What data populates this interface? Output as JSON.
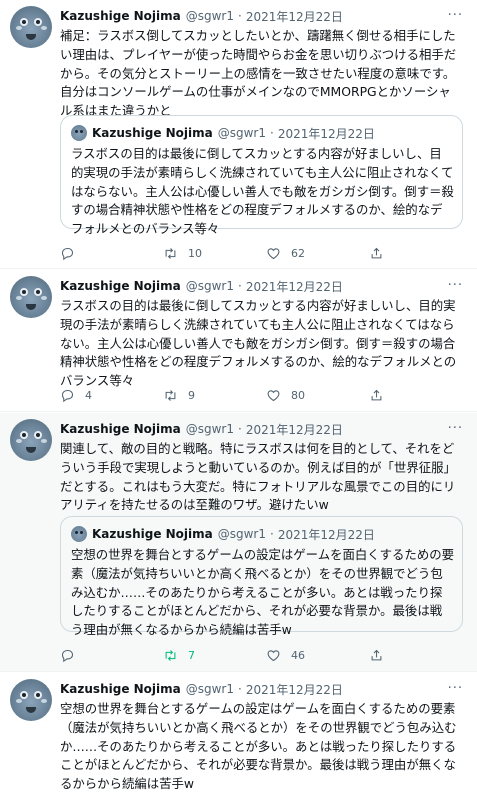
{
  "tweets": [
    {
      "author": "Kazushige Nojima",
      "handle": "@sgwr1",
      "date": "2021年12月22日",
      "text": "補足：ラスボス倒してスカッとしたいとか、躊躇無く倒せる相手にしたい理由は、プレイヤーが使った時間やらお金を思い切りぶつける相手だから。その気分とストーリー上の感情を一致させたい程度の意味です。自分はコンソールゲームの仕事がメインなのでMMORPGとかソーシャル系はまた違うかと",
      "quote": {
        "author": "Kazushige Nojima",
        "handle": "@sgwr1",
        "date": "2021年12月22日",
        "text": "ラスボスの目的は最後に倒してスカッとする内容が好ましいし、目的実現の手法が素晴らしく洗練されていても主人公に阻止されなくてはならない。主人公は心優しい善人でも敵をガシガシ倒す。倒す＝殺すの場合精神状態や性格をどの程度デフォルメするのか、絵的なデフォルメとのバランス等々"
      },
      "reply_count": "",
      "retweet_count": "10",
      "like_count": "62"
    },
    {
      "author": "Kazushige Nojima",
      "handle": "@sgwr1",
      "date": "2021年12月22日",
      "text": "ラスボスの目的は最後に倒してスカッとする内容が好ましいし、目的実現の手法が素晴らしく洗練されていても主人公に阻止されなくてはならない。主人公は心優しい善人でも敵をガシガシ倒す。倒す＝殺すの場合精神状態や性格をどの程度デフォルメするのか、絵的なデフォルメとのバランス等々",
      "reply_count": "4",
      "retweet_count": "9",
      "like_count": "80"
    },
    {
      "author": "Kazushige Nojima",
      "handle": "@sgwr1",
      "date": "2021年12月22日",
      "text": "関連して、敵の目的と戦略。特にラスボスは何を目的として、それをどういう手段で実現しようと動いているのか。例えば目的が「世界征服」だとする。これはもう大変だ。特にフォトリアルな風景でこの目的にリアリティを持たせるのは至難のワザ。避けたいw",
      "quote": {
        "author": "Kazushige Nojima",
        "handle": "@sgwr1",
        "date": "2021年12月22日",
        "text": "空想の世界を舞台とするゲームの設定はゲームを面白くするための要素（魔法が気持ちいいとか高く飛べるとか）をその世界観でどう包み込むか……そのあたりから考えることが多い。あとは戦ったり探したりすることがほとんどだから、それが必要な背景か。最後は戦う理由が無くなるからから続編は苦手w"
      },
      "reply_count": "",
      "retweet_count": "7",
      "like_count": "46",
      "retweeted": true
    },
    {
      "author": "Kazushige Nojima",
      "handle": "@sgwr1",
      "date": "2021年12月22日",
      "text": "空想の世界を舞台とするゲームの設定はゲームを面白くするための要素（魔法が気持ちいいとか高く飛べるとか）をその世界観でどう包み込むか……そのあたりから考えることが多い。あとは戦ったり探したりすることがほとんどだから、それが必要な背景か。最後は戦う理由が無くなるからから続編は苦手w"
    }
  ],
  "accent_colors": {
    "retweet_active": "#00ba7c",
    "muted": "#536471",
    "highlight_bg": "#f7f9f9"
  },
  "icons": {
    "more": "more-dots-icon",
    "reply": "reply-icon",
    "retweet": "retweet-icon",
    "like": "heart-icon"
  }
}
